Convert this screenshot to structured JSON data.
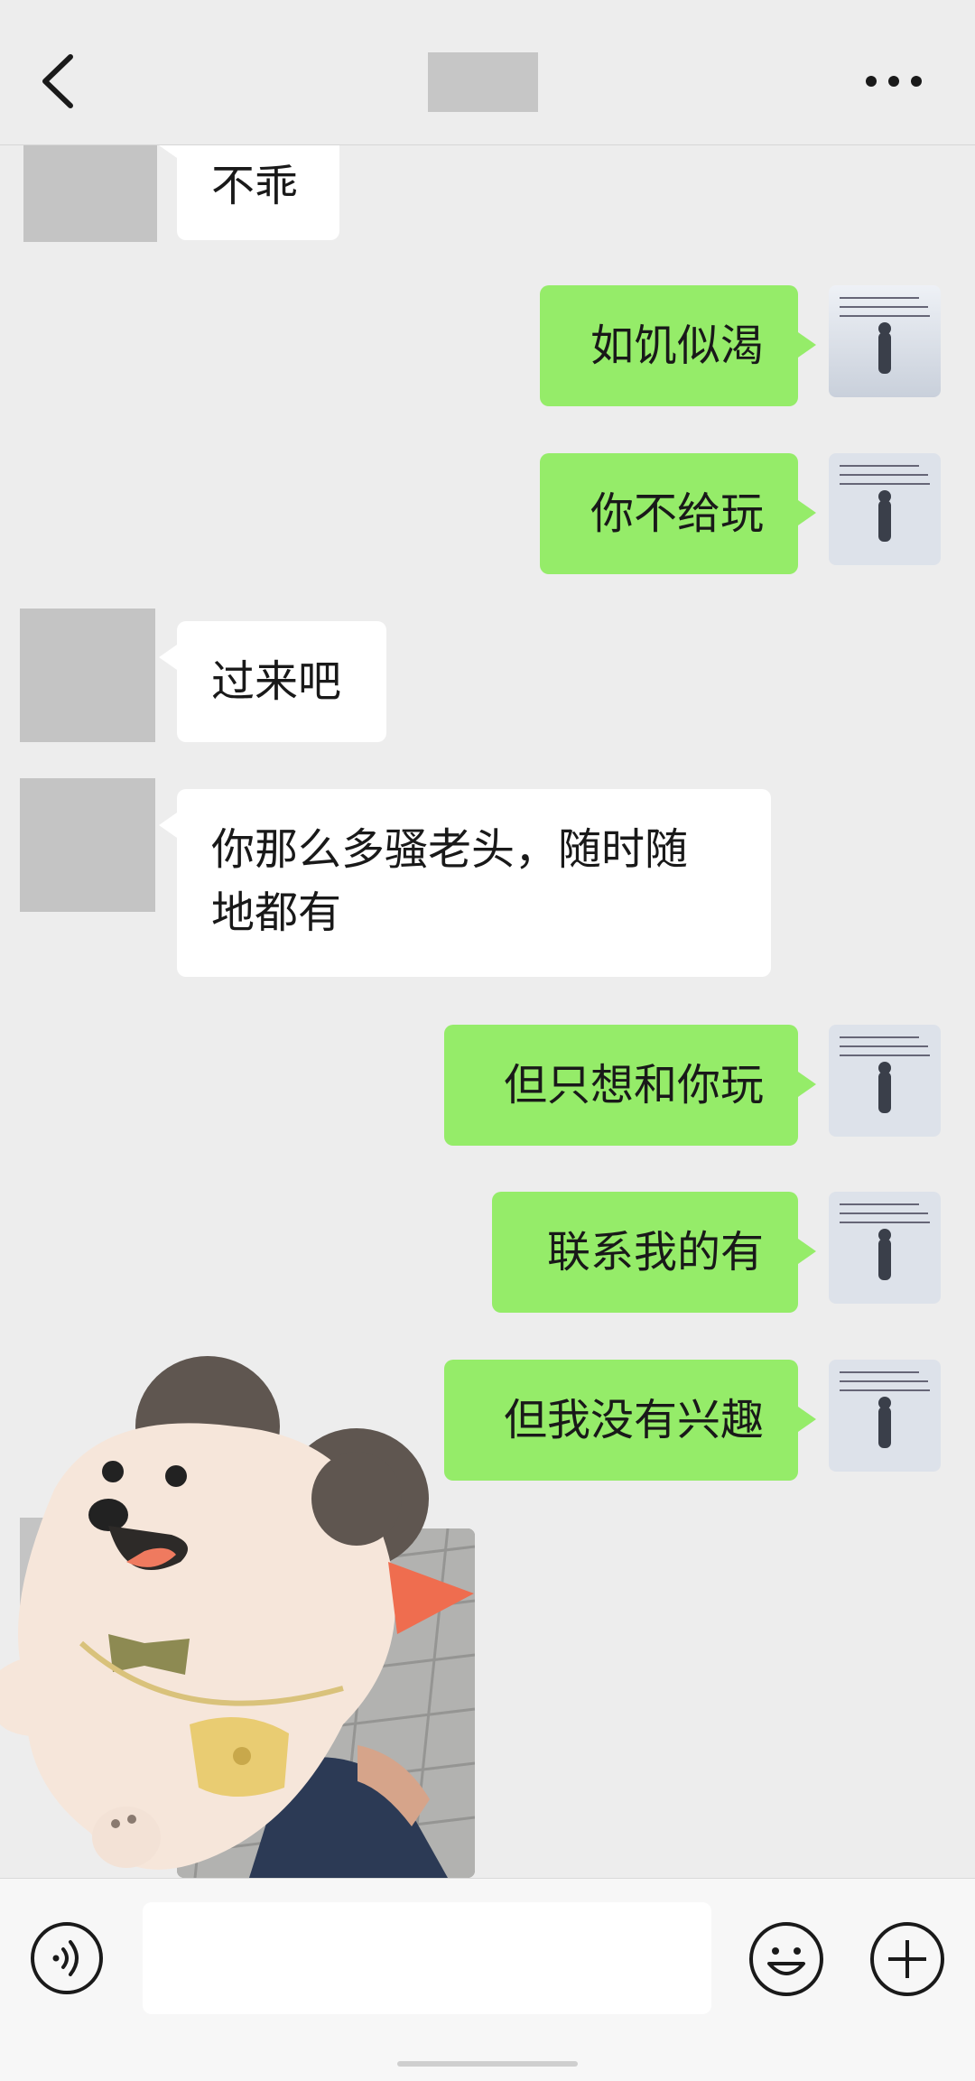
{
  "header": {
    "back": "back-arrow-icon",
    "more": "more-dots-icon"
  },
  "messages": [
    {
      "side": "in",
      "text": "不乖"
    },
    {
      "side": "out",
      "text": "如饥似渴"
    },
    {
      "side": "out",
      "text": "你不给玩"
    },
    {
      "side": "in",
      "text": "过来吧"
    },
    {
      "side": "in",
      "lines": [
        "你那么多骚老头，随时随",
        "地都有"
      ]
    },
    {
      "side": "out",
      "text": "但只想和你玩"
    },
    {
      "side": "out",
      "text": "联系我的有"
    },
    {
      "side": "out",
      "text": "但我没有兴趣"
    },
    {
      "side": "in",
      "type": "image",
      "description": "photo"
    }
  ],
  "input": {
    "placeholder": "",
    "value": ""
  },
  "icons": {
    "voice": "voice-icon",
    "emoji": "emoji-icon",
    "plus": "plus-icon"
  },
  "colors": {
    "background": "#ededed",
    "incoming_bubble": "#ffffff",
    "outgoing_bubble": "#95ec69",
    "redaction": "#c4c4c4"
  }
}
